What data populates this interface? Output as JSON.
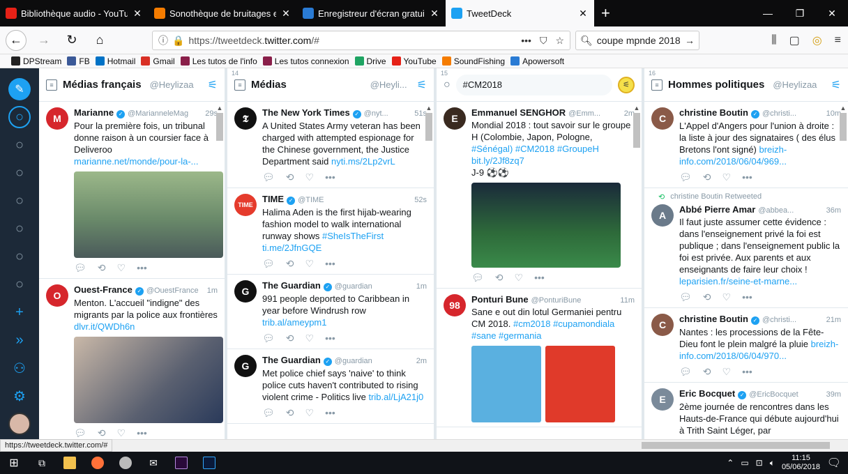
{
  "tabs": [
    {
      "title": "Bibliothèque audio - YouTube",
      "icon": "youtube-icon",
      "color": "#e62117",
      "active": false
    },
    {
      "title": "Sonothèque de bruitages et m",
      "icon": "soundfishing-icon",
      "color": "#f57c00",
      "active": false
    },
    {
      "title": "Enregistreur d'écran gratuit - e",
      "icon": "apowersoft-icon",
      "color": "#2a7bd4",
      "active": false
    },
    {
      "title": "TweetDeck",
      "icon": "twitter-icon",
      "color": "#1da1f2",
      "active": true
    }
  ],
  "address": {
    "prefix": "https://tweetdeck.",
    "domain": "twitter.com",
    "suffix": "/#"
  },
  "search": {
    "value": "coupe mpnde 2018"
  },
  "bookmarks": [
    {
      "label": "DPStream",
      "icon": "dpstream-icon",
      "color": "#222"
    },
    {
      "label": "FB",
      "icon": "facebook-icon",
      "color": "#3b5998"
    },
    {
      "label": "Hotmail",
      "icon": "outlook-icon",
      "color": "#0072c6"
    },
    {
      "label": "Gmail",
      "icon": "gmail-icon",
      "color": "#d93025"
    },
    {
      "label": "Les tutos de l'info",
      "icon": "tutos-icon",
      "color": "#8a1f4a"
    },
    {
      "label": "Les tutos connexion",
      "icon": "tutos-icon",
      "color": "#8a1f4a"
    },
    {
      "label": "Drive",
      "icon": "drive-icon",
      "color": "#1fa463"
    },
    {
      "label": "YouTube",
      "icon": "youtube-icon",
      "color": "#e62117"
    },
    {
      "label": "SoundFishing",
      "icon": "soundfishing-icon",
      "color": "#f57c00"
    },
    {
      "label": "Apowersoft",
      "icon": "apowersoft-icon",
      "color": "#2a7bd4"
    }
  ],
  "columns": [
    {
      "num": "",
      "title": "Médias français",
      "sub": "@Heylizaa",
      "tweets": [
        {
          "name": "Marianne",
          "handle": "@MarianneleMag",
          "time": "29s",
          "avatar": "#d6262c",
          "initial": "M",
          "text": "Pour la première fois, un tribunal donne raison à un coursier face à Deliveroo ",
          "link": "marianne.net/monde/pour-la-...",
          "media": "#7a9a6a"
        },
        {
          "name": "Ouest-France",
          "handle": "@OuestFrance",
          "time": "1m",
          "avatar": "#d6262c",
          "initial": "O",
          "text": "Menton. L'accueil \"indigne\" des migrants par la police aux frontières ",
          "link": "dlvr.it/QWDh6n",
          "media": "#5a6070"
        }
      ]
    },
    {
      "num": "14",
      "title": "Médias",
      "sub": "@Heyli...",
      "tweets": [
        {
          "name": "The New York Times",
          "handle": "@nyt...",
          "time": "51s",
          "avatar": "#111",
          "initial": "T",
          "text": "A United States Army veteran has been charged with attempted espionage for the Chinese government, the Justice Department said ",
          "link": "nyti.ms/2Lp2vrL"
        },
        {
          "name": "TIME",
          "handle": "@TIME",
          "time": "52s",
          "avatar": "#e53b2c",
          "initial": "TIME",
          "text": "Halima Aden is the first hijab-wearing fashion model to walk international runway shows ",
          "link": "#SheIsTheFirst ti.me/2JfnGQE"
        },
        {
          "name": "The Guardian",
          "handle": "@guardian",
          "time": "1m",
          "avatar": "#111",
          "initial": "G",
          "text": "991 people deported to Caribbean in year before Windrush row ",
          "link": "trib.al/ameypm1"
        },
        {
          "name": "The Guardian",
          "handle": "@guardian",
          "time": "2m",
          "avatar": "#111",
          "initial": "G",
          "text": "Met police chief says 'naive' to think police cuts haven't contributed to rising violent crime - Politics live ",
          "link": "trib.al/LjA21j0"
        }
      ]
    },
    {
      "num": "15",
      "title": "#CM2018",
      "sub": "",
      "tweets": [
        {
          "name": "Emmanuel SENGHOR",
          "handle": "@Emm...",
          "time": "2m",
          "avatar": "#3a2a20",
          "initial": "E",
          "text": "Mondial 2018 : tout savoir sur le groupe H (Colombie, Japon, Pologne, ",
          "link": "#Sénégal) #CM2018 #GroupeH bit.ly/2Jf8zq7",
          "extra": "J-9 ⚽⚽",
          "media": "#2e6b3a"
        },
        {
          "name": "Ponturi Bune",
          "handle": "@PonturiBune",
          "time": "11m",
          "avatar": "#d6262c",
          "initial": "98",
          "text": "Sane e out din lotul Germaniei pentru CM 2018. ",
          "link": "#cm2018 #cupamondiala #sane #germania"
        }
      ]
    },
    {
      "num": "16",
      "title": "Hommes politiques",
      "sub": "@Heylizaa",
      "tweets": [
        {
          "name": "christine Boutin",
          "handle": "@christi...",
          "time": "10m",
          "avatar": "#8a5a48",
          "initial": "C",
          "text": "L'Appel d'Angers pour l'union à droite : la liste à jour des signataires ( des élus Bretons l'ont signé) ",
          "link": "breizh-info.com/2018/06/04/969..."
        },
        {
          "retweet": "christine Boutin Retweeted",
          "name": "Abbé Pierre Amar",
          "handle": "@abbea...",
          "time": "36m",
          "avatar": "#6a7a8a",
          "initial": "A",
          "text": "Il faut juste assumer cette évidence : dans l'enseignement privé la foi est publique ; dans l'enseignement public la foi est privée. Aux parents et aux enseignants de faire leur choix ! ",
          "link": "leparisien.fr/seine-et-marne..."
        },
        {
          "name": "christine Boutin",
          "handle": "@christi...",
          "time": "21m",
          "avatar": "#8a5a48",
          "initial": "C",
          "text": "Nantes : les processions de la Fête-Dieu font le plein malgré la pluie ",
          "link": "breizh-info.com/2018/06/04/970..."
        },
        {
          "name": "Eric Bocquet",
          "handle": "@EricBocquet",
          "time": "39m",
          "avatar": "#7a8a9a",
          "initial": "E",
          "text": "2ème journée de rencontres dans les Hauts-de-France qui débute aujourd'hui à Trith Saint Léger, par",
          "link": ""
        }
      ]
    }
  ],
  "status_url": "https://tweetdeck.twitter.com/#",
  "clock": {
    "time": "11:15",
    "date": "05/06/2018"
  }
}
